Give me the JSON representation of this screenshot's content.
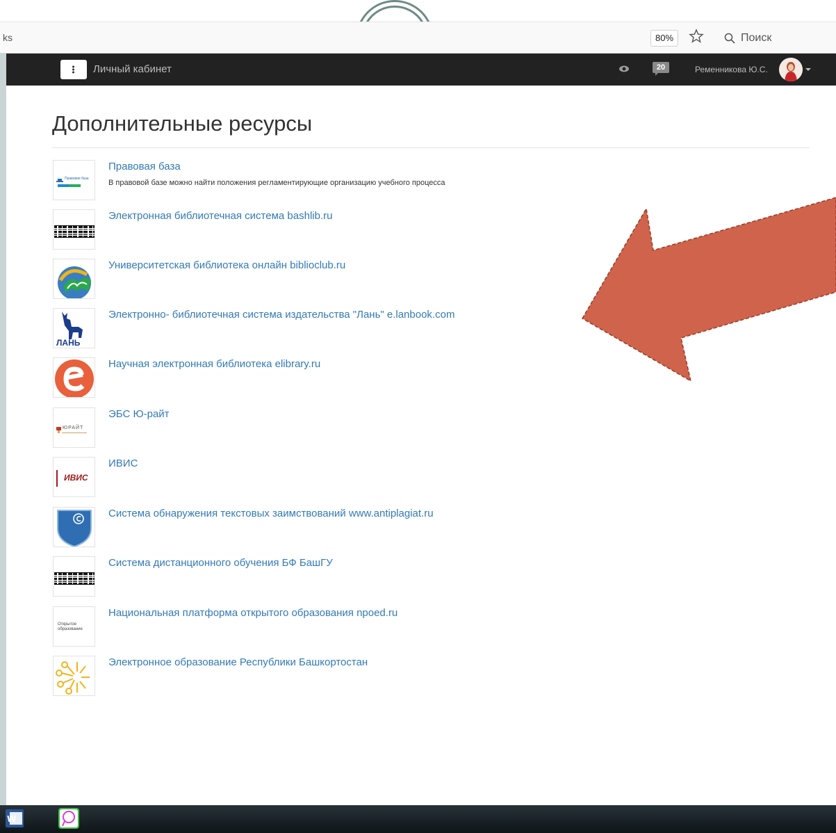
{
  "browser": {
    "url_fragment": "ks",
    "zoom": "80%",
    "search_placeholder": "Поиск"
  },
  "nav": {
    "title": "Личный кабинет",
    "notifications_count": "20",
    "user_name": "Ременникова Ю.С."
  },
  "page": {
    "title": "Дополнительные ресурсы"
  },
  "resources": [
    {
      "title": "Правовая база",
      "description": "В правовой базе можно найти положения регламентирующие организацию учебного процесса",
      "thumb_text": "Правовая база",
      "icon": "legal-base-logo"
    },
    {
      "title": "Электронная библиотечная система bashlib.ru",
      "description": "",
      "icon": "bashlib-logo"
    },
    {
      "title": "Университетская библиотека онлайн biblioclub.ru",
      "description": "",
      "icon": "biblioclub-logo"
    },
    {
      "title": "Электронно- библиотечная система издательства \"Лань\" e.lanbook.com",
      "description": "",
      "thumb_text": "ЛАНЬ",
      "icon": "lan-logo"
    },
    {
      "title": "Научная электронная библиотека elibrary.ru",
      "description": "",
      "icon": "elibrary-logo"
    },
    {
      "title": "ЭБС Ю-райт",
      "description": "",
      "thumb_text": "ЮРАЙТ",
      "icon": "urait-logo"
    },
    {
      "title": "ИВИС",
      "description": "",
      "thumb_text": "ИВИС",
      "icon": "ivis-logo"
    },
    {
      "title": "Система обнаружения текстовых заимствований www.antiplagiat.ru",
      "description": "",
      "icon": "antiplagiat-logo"
    },
    {
      "title": "Система дистанционного обучения БФ БашГУ",
      "description": "",
      "icon": "distance-learning-logo"
    },
    {
      "title": "Национальная платформа открытого образования npoed.ru",
      "description": "",
      "thumb_text": "Открытое образование",
      "icon": "npoed-logo"
    },
    {
      "title": "Электронное образование Республики Башкортостан",
      "description": "",
      "icon": "edu-rb-logo"
    }
  ],
  "colors": {
    "nav_bg": "#222222",
    "link": "#337ab7",
    "arrow": "#d0634b",
    "taskbar": "#1b2428"
  }
}
